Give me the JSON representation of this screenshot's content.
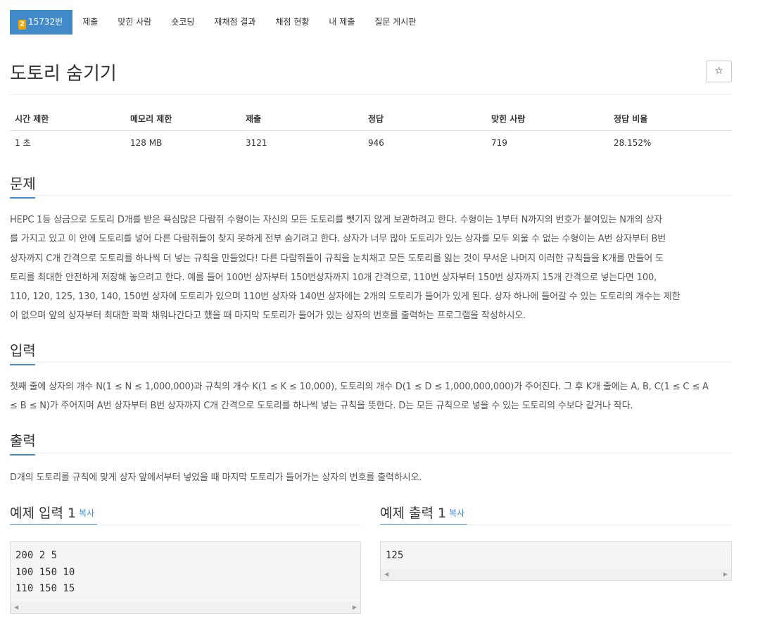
{
  "nav": {
    "problem_tab": {
      "tier": "2",
      "label": "15732번"
    },
    "items": [
      "제출",
      "맞힌 사람",
      "숏코딩",
      "재채점 결과",
      "채점 현황",
      "내 제출",
      "질문 게시판"
    ]
  },
  "title": "도토리 숨기기",
  "star_icon": "☆",
  "info": {
    "headers": [
      "시간 제한",
      "메모리 제한",
      "제출",
      "정답",
      "맞힌 사람",
      "정답 비율"
    ],
    "values": [
      "1 초",
      "128 MB",
      "3121",
      "946",
      "719",
      "28.152%"
    ]
  },
  "sections": {
    "problem": {
      "heading": "문제",
      "lines": [
        "HEPC 1등 상금으로 도토리 D개를 받은 욕심많은 다람쥐 수형이는 자신의 모든 도토리를 뺏기지 않게 보관하려고 한다. 수형이는 1부터 N까지의 번호가 붙여있는 N개의 상자",
        "를 가지고 있고 이 안에 도토리를 넣어 다른 다람쥐들이 찾지 못하게 전부 숨기려고 한다. 상자가 너무 많아 도토리가 있는 상자를 모두 외울 수 없는 수형이는 A번 상자부터 B번",
        "상자까지 C개 간격으로 도토리를 하나씩 더 넣는 규칙을 만들었다! 다른 다람쥐들이 규칙을 눈치채고 모든 도토리를 잃는 것이 무서운 나머지 이러한 규칙들을 K개를 만들어 도",
        "토리를 최대한 안전하게 저장해 놓으려고 한다. 예를 들어 100번 상자부터 150번상자까지 10개 간격으로, 110번 상자부터 150번 상자까지 15개 간격으로 넣는다면 100,",
        "110, 120, 125, 130, 140, 150번 상자에 도토리가 있으며 110번 상자와 140번 상자에는 2개의 도토리가 들어가 있게 된다. 상자 하나에 들어갈 수 있는 도토리의 개수는 제한",
        "이 없으며 앞의 상자부터 최대한 꽉꽉 채워나간다고 했을 때 마지막 도토리가 들어가 있는 상자의 번호를 출력하는 프로그램을 작성하시오."
      ]
    },
    "input": {
      "heading": "입력",
      "lines": [
        "첫째 줄에 상자의 개수 N(1 ≤ N ≤ 1,000,000)과 규칙의 개수 K(1 ≤ K ≤ 10,000), 도토리의 개수 D(1 ≤ D ≤ 1,000,000,000)가 주어진다. 그 후 K개 줄에는 A, B, C(1 ≤ C ≤ A",
        "≤ B ≤ N)가 주어지며 A번 상자부터 B번 상자까지 C개 간격으로 도토리를 하나씩 넣는 규칙을 뜻한다. D는 모든 규칙으로 넣을 수 있는 도토리의 수보다 같거나 작다."
      ]
    },
    "output": {
      "heading": "출력",
      "lines": [
        "D개의 도토리를 규칙에 맞게 상자 앞에서부터 넣었을 때 마지막 도토리가 들어가는 상자의 번호를 출력하시오."
      ]
    }
  },
  "samples": {
    "input": {
      "heading": "예제 입력 1",
      "copy": "복사",
      "content": "200 2 5\n100 150 10\n110 150 15"
    },
    "output": {
      "heading": "예제 출력 1",
      "copy": "복사",
      "content": "125"
    }
  },
  "colors": {
    "primary": "#428bca",
    "tier_badge": "#f0a500"
  }
}
